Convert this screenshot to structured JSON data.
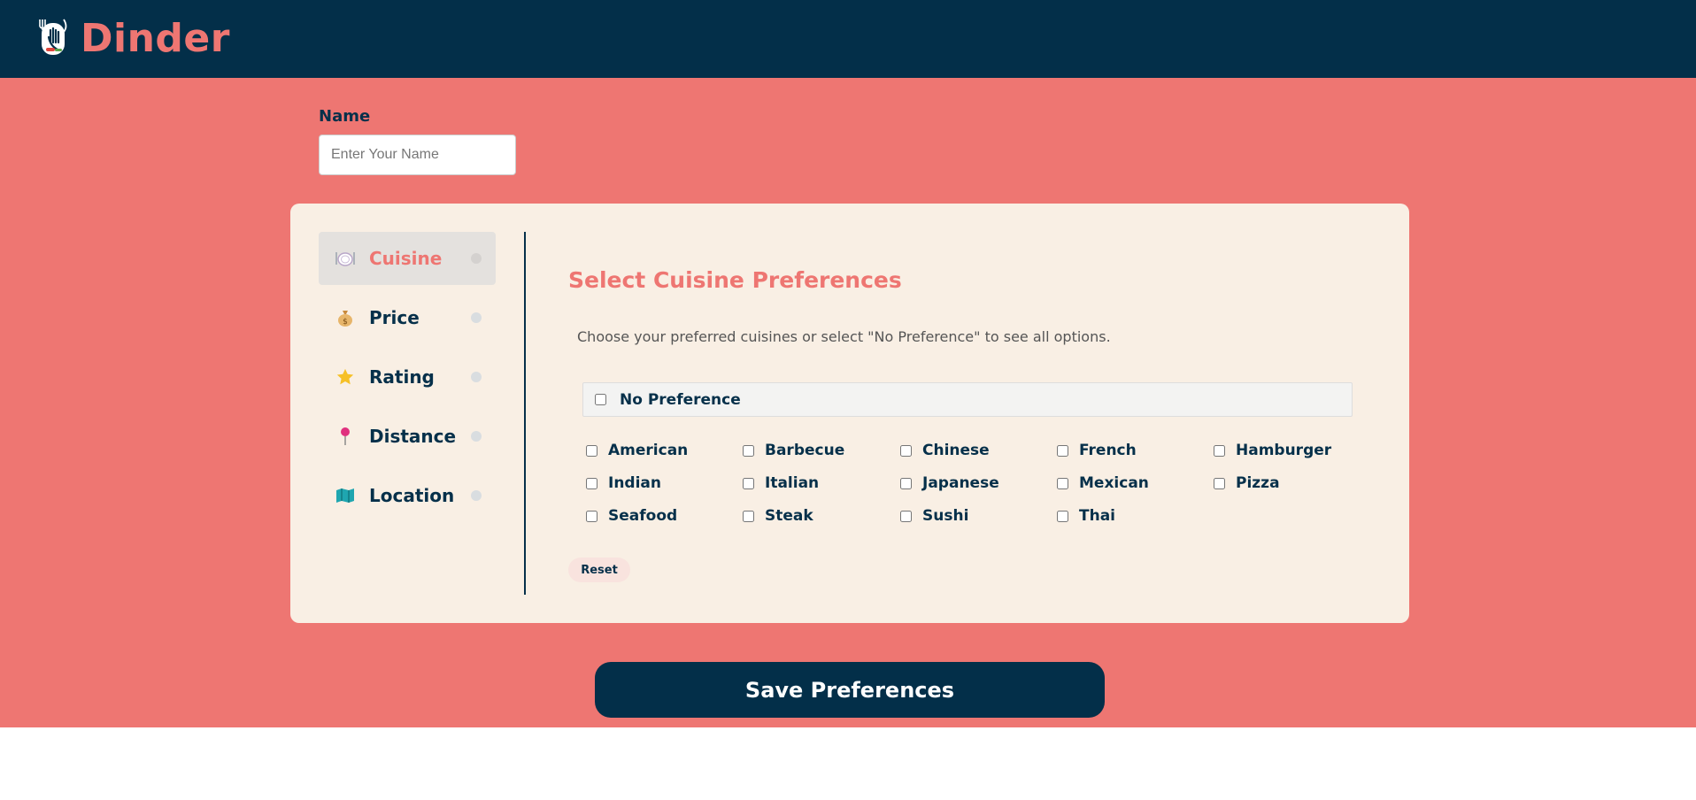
{
  "app": {
    "brand": "Dinder",
    "colors": {
      "header": "#032f49",
      "accent": "#ee7672",
      "card": "#f9efe4",
      "text": "#06304a"
    }
  },
  "name_field": {
    "label": "Name",
    "placeholder": "Enter Your Name",
    "value": ""
  },
  "nav": {
    "items": [
      {
        "label": "Cuisine",
        "icon": "plate-icon",
        "active": true
      },
      {
        "label": "Price",
        "icon": "money-bag-icon",
        "active": false
      },
      {
        "label": "Rating",
        "icon": "star-icon",
        "active": false
      },
      {
        "label": "Distance",
        "icon": "pin-icon",
        "active": false
      },
      {
        "label": "Location",
        "icon": "map-icon",
        "active": false
      }
    ]
  },
  "cuisine": {
    "title": "Select Cuisine Preferences",
    "description": "Choose your preferred cuisines or select \"No Preference\" to see all options.",
    "no_preference": "No Preference",
    "options": [
      "American",
      "Barbecue",
      "Chinese",
      "French",
      "Hamburger",
      "Indian",
      "Italian",
      "Japanese",
      "Mexican",
      "Pizza",
      "Seafood",
      "Steak",
      "Sushi",
      "Thai"
    ],
    "reset_label": "Reset"
  },
  "save_label": "Save Preferences"
}
